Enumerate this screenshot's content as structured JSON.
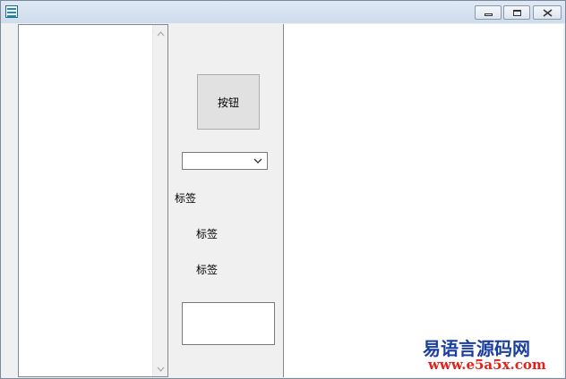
{
  "window": {
    "icon": "app-icon",
    "controls": [
      "minimize-icon",
      "restore-icon",
      "close-icon"
    ]
  },
  "left_list": {
    "scroll_up": "chevron-up-icon",
    "scroll_down": "chevron-down-icon"
  },
  "button": {
    "label": "按钮"
  },
  "combo": {
    "value": "",
    "icon": "chevron-down-icon"
  },
  "labels": [
    "标签",
    "标签",
    "标签"
  ],
  "edit": {
    "value": ""
  },
  "watermark": {
    "line1": "易语言源码网",
    "line2": "www.e5a5x.com"
  },
  "colors": {
    "watermark_blue": "#1b3f9c",
    "watermark_red": "#e0221b"
  }
}
